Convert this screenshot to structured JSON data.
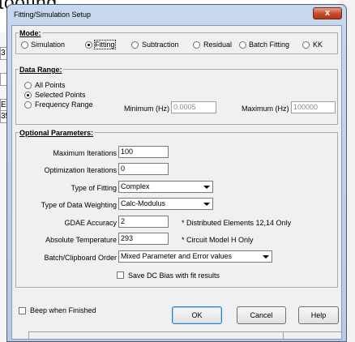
{
  "background": {
    "title_fragment": "tooting",
    "left_cells": [
      "3",
      "",
      "E-(",
      "35"
    ]
  },
  "window": {
    "title": "Fitting/Simulation Setup",
    "close_glyph": "x"
  },
  "mode": {
    "title": "Mode:",
    "options": [
      "Simulation",
      "Fitting",
      "Subtraction",
      "Residual",
      "Batch Fitting",
      "KK"
    ],
    "selected": "Fitting"
  },
  "data_range": {
    "title": "Data Range:",
    "options": [
      "All Points",
      "Selected Points",
      "Frequency Range"
    ],
    "selected": "Selected Points",
    "minimum_label": "Minimum (Hz)",
    "minimum_value": "0.0005",
    "maximum_label": "Maximum (Hz)",
    "maximum_value": "100000"
  },
  "optional": {
    "title": "Optional Parameters:",
    "max_iterations_label": "Maximum Iterations",
    "max_iterations_value": "100",
    "opt_iterations_label": "Optimization Iterations",
    "opt_iterations_value": "0",
    "fitting_type_label": "Type of Fitting",
    "fitting_type_value": "Complex",
    "weighting_label": "Type of Data Weighting",
    "weighting_value": "Calc-Modulus",
    "gdae_label": "GDAE Accuracy",
    "gdae_value": "2",
    "gdae_note": "* Distributed Elements 12,14 Only",
    "abs_temp_label": "Absolute Temperature",
    "abs_temp_value": "293",
    "abs_temp_note": "* Circuit Model H Only",
    "batch_label": "Batch/Clipboard Order",
    "batch_value": "Mixed Parameter and Error values",
    "save_dc_label": "Save DC Bias with fit results",
    "save_dc_checked": false
  },
  "footer": {
    "beep_label": "Beep when Finished",
    "beep_checked": false,
    "ok_label": "OK",
    "cancel_label": "Cancel",
    "help_label": "Help"
  }
}
